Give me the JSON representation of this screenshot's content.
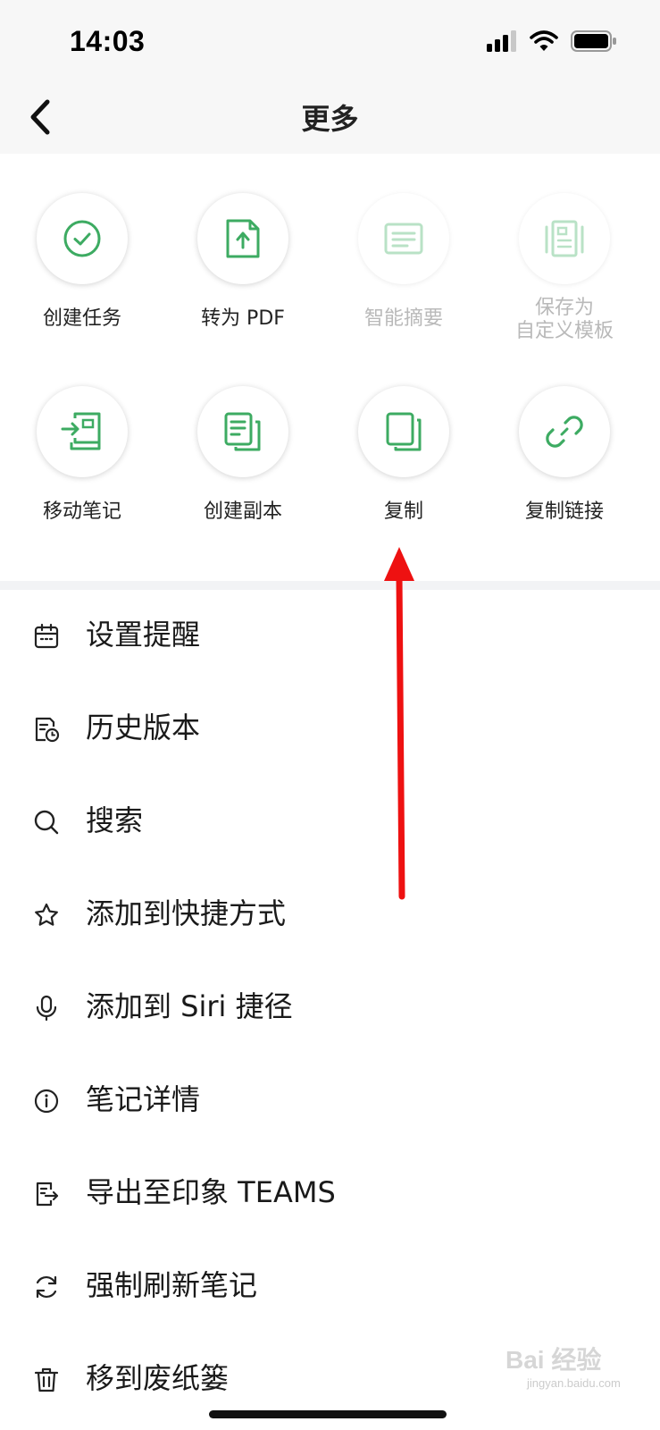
{
  "status_bar": {
    "time": "14:03"
  },
  "header": {
    "title": "更多",
    "back_icon": "chevron-left-icon"
  },
  "grid_items": [
    {
      "label": "创建任务",
      "icon": "check-circle-icon",
      "enabled": true
    },
    {
      "label": "转为 PDF",
      "icon": "file-upload-icon",
      "enabled": true
    },
    {
      "label": "智能摘要",
      "icon": "summary-icon",
      "enabled": false
    },
    {
      "label_line1": "保存为",
      "label_line2": "自定义模板",
      "icon": "template-icon",
      "enabled": false
    },
    {
      "label": "移动笔记",
      "icon": "move-note-icon",
      "enabled": true
    },
    {
      "label": "创建副本",
      "icon": "duplicate-icon",
      "enabled": true
    },
    {
      "label": "复制",
      "icon": "copy-icon",
      "enabled": true
    },
    {
      "label": "复制链接",
      "icon": "link-icon",
      "enabled": true
    }
  ],
  "menu_items": [
    {
      "label": "设置提醒",
      "icon": "calendar-icon"
    },
    {
      "label": "历史版本",
      "icon": "history-icon"
    },
    {
      "label": "搜索",
      "icon": "search-icon"
    },
    {
      "label": "添加到快捷方式",
      "icon": "star-icon"
    },
    {
      "label": "添加到 Siri 捷径",
      "icon": "microphone-icon"
    },
    {
      "label": "笔记详情",
      "icon": "info-icon"
    },
    {
      "label": "导出至印象 TEAMS",
      "icon": "export-icon"
    },
    {
      "label": "强制刷新笔记",
      "icon": "refresh-icon"
    },
    {
      "label": "移到废纸篓",
      "icon": "trash-icon"
    }
  ],
  "colors": {
    "accent": "#3dab62",
    "accent_disabled": "#b9e2c6",
    "annotation_arrow": "#ee1111"
  },
  "watermark": {
    "text": "Bai 经验",
    "sub": "jingyan.baidu.com"
  }
}
